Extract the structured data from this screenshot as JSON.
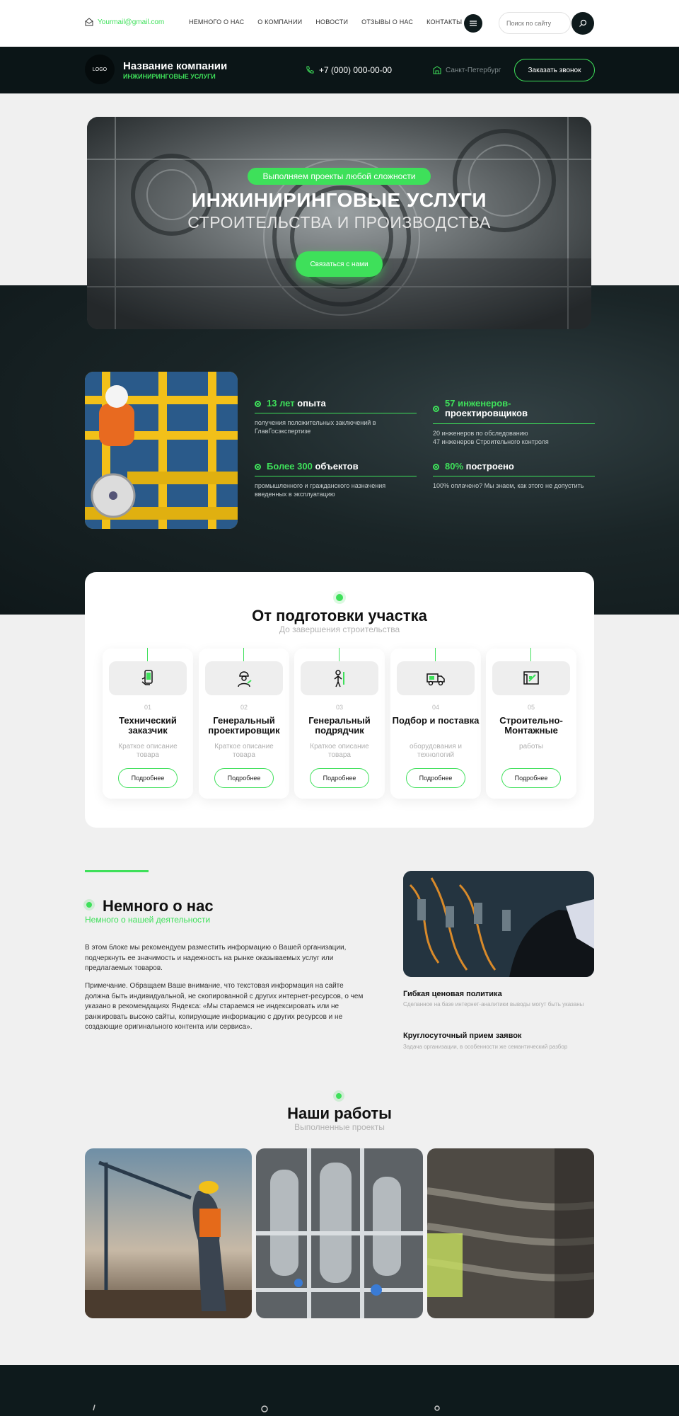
{
  "topbar": {
    "email": "Yourmail@gmail.com",
    "nav": [
      "НЕМНОГО О НАС",
      "О КОМПАНИИ",
      "НОВОСТИ",
      "ОТЗЫВЫ О НАС",
      "КОНТАКТЫ"
    ],
    "search_placeholder": "Поиск по сайту"
  },
  "header": {
    "logo": "LOGO",
    "company_name": "Название компании",
    "company_tagline": "ИНЖИНИРИНГОВЫЕ УСЛУГИ",
    "phone": "+7 (000) 000-00-00",
    "city": "Санкт-Петербург",
    "call_button": "Заказать звонок"
  },
  "hero": {
    "pill": "Выполняем проекты любой сложности",
    "title": "ИНЖИНИРИНГОВЫЕ УСЛУГИ",
    "subtitle": "СТРОИТЕЛЬСТВА И ПРОИЗВОДСТВА",
    "cta": "Связаться с нами"
  },
  "stats": [
    {
      "highlight": "13 лет",
      "rest": "опыта",
      "desc": "получения положительных заключений в ГлавГосэкспертизе"
    },
    {
      "highlight": "57 инженеров-",
      "rest": "проектировщиков",
      "desc": "20 инженеров по обследованию\n47 инженеров Строительного контроля"
    },
    {
      "highlight": "Более 300",
      "rest": "объектов",
      "desc": "промышленного и гражданского назначения введенных в эксплуатацию"
    },
    {
      "highlight": "80%",
      "rest": "построено",
      "desc": "100% оплачено? Мы знаем, как этого не допустить"
    }
  ],
  "services": {
    "title": "От подготовки участка",
    "subtitle": "До завершения строительства",
    "items": [
      {
        "num": "01",
        "name": "Технический заказчик",
        "desc": "Краткое описание товара",
        "button": "Подробнее",
        "icon": "phone-hand-icon"
      },
      {
        "num": "02",
        "name": "Генеральный проектировщик",
        "desc": "Краткое описание товара",
        "button": "Подробнее",
        "icon": "engineer-icon"
      },
      {
        "num": "03",
        "name": "Генеральный подрядчик",
        "desc": "Краткое описание товара",
        "button": "Подробнее",
        "icon": "worker-tools-icon"
      },
      {
        "num": "04",
        "name": "Подбор и поставка",
        "desc": "оборудования и технологий",
        "button": "Подробнее",
        "icon": "truck-icon"
      },
      {
        "num": "05",
        "name": "Строительно-Монтажные",
        "desc": "работы",
        "button": "Подробнее",
        "icon": "blueprint-icon"
      }
    ]
  },
  "about": {
    "title": "Немного о нас",
    "subtitle": "Немного о нашей деятельности",
    "p1": "В этом блоке мы рекомендуем разместить информацию о Вашей организации, подчеркнуть ее значимость и надежность на рынке оказываемых услуг или предлагаемых товаров.",
    "p2": "Примечание. Обращаем Ваше внимание, что текстовая информация на сайте должна быть индивидуальной, не скопированной с других интернет-ресурсов, о чем указано в рекомендациях Яндекса: «Мы стараемся не индексировать или не ранжировать высоко сайты, копирующие информацию с других ресурсов и не создающие оригинального контента или сервиса».",
    "features": [
      {
        "title": "Гибкая ценовая политика",
        "desc": "Сделанное на базе интернет-аналитики выводы могут быть указаны"
      },
      {
        "title": "Круглосуточный прием заявок",
        "desc": "Задача организации, в особенности же семантический разбор"
      }
    ]
  },
  "works": {
    "title": "Наши работы",
    "subtitle": "Выполненные проекты"
  },
  "colors": {
    "accent": "#3ee05a",
    "dark": "#0b1517"
  }
}
